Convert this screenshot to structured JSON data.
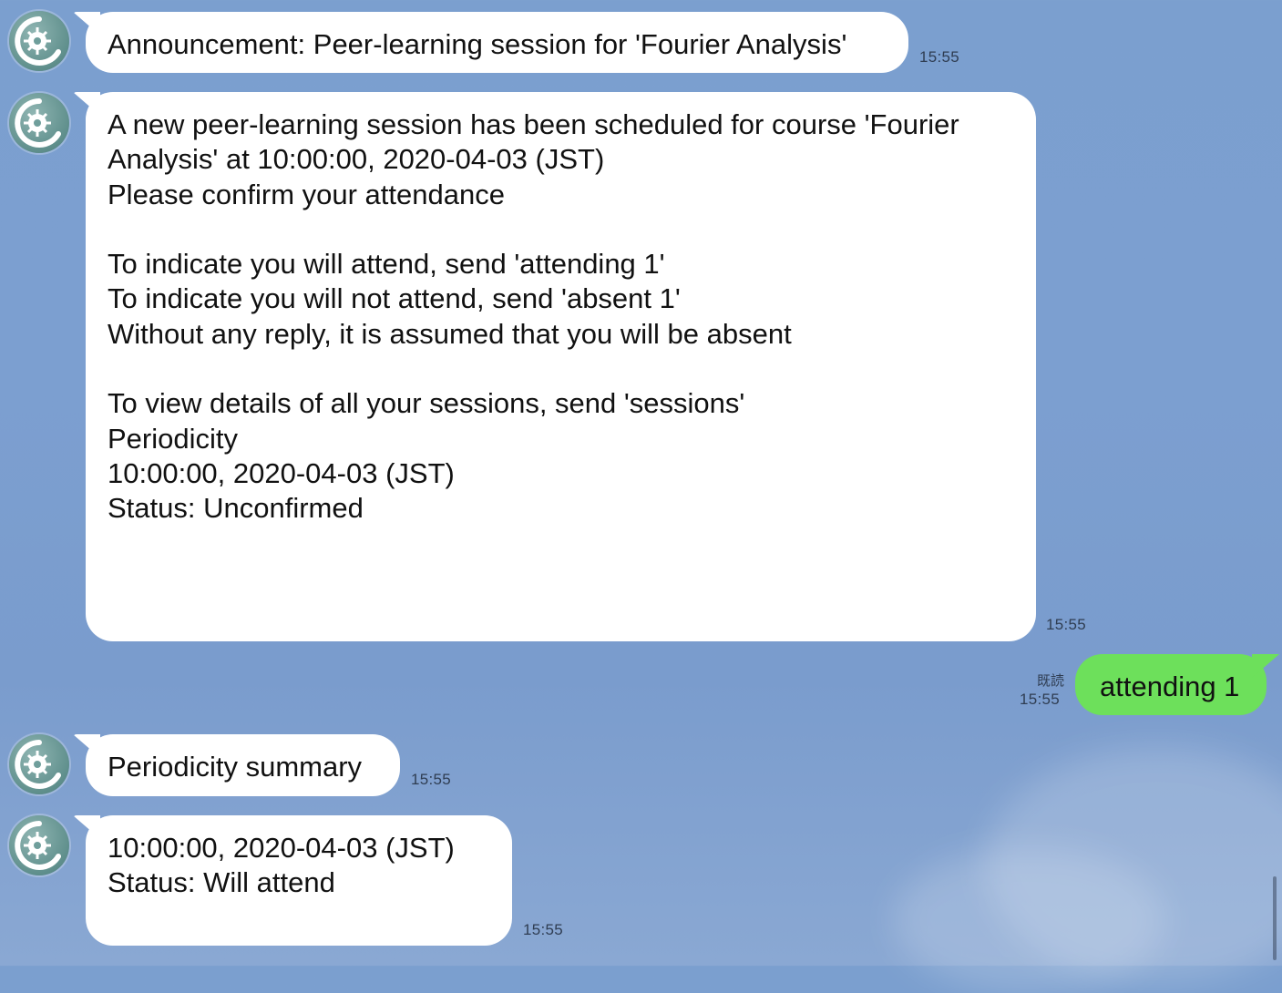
{
  "messages": [
    {
      "id": "m1",
      "sender": "bot",
      "lines": [
        "Announcement: Peer-learning session for 'Fourier Analysis'"
      ],
      "time": "15:55"
    },
    {
      "id": "m2",
      "sender": "bot",
      "lines": [
        "A new peer-learning session has been scheduled for course 'Fourier",
        "Analysis' at 10:00:00, 2020-04-03 (JST)",
        "Please confirm your attendance",
        "",
        "To indicate you will attend, send 'attending 1'",
        "To indicate you will not attend, send 'absent 1'",
        "Without any reply, it is assumed that you will be absent",
        "",
        "To view details of all your sessions, send 'sessions'",
        "Periodicity",
        "10:00:00, 2020-04-03 (JST)",
        "Status: Unconfirmed"
      ],
      "time": "15:55"
    },
    {
      "id": "m3",
      "sender": "me",
      "lines": [
        "attending 1"
      ],
      "time": "15:55",
      "read_label": "既読"
    },
    {
      "id": "m4",
      "sender": "bot",
      "lines": [
        "Periodicity summary"
      ],
      "time": "15:55"
    },
    {
      "id": "m5",
      "sender": "bot",
      "lines": [
        "10:00:00, 2020-04-03 (JST)",
        "Status: Will attend"
      ],
      "time": "15:55"
    }
  ],
  "avatar_icon": "gear-c-logo-icon",
  "colors": {
    "bot_bubble": "#ffffff",
    "my_bubble": "#6de05b",
    "background": "#7b9fcf"
  }
}
